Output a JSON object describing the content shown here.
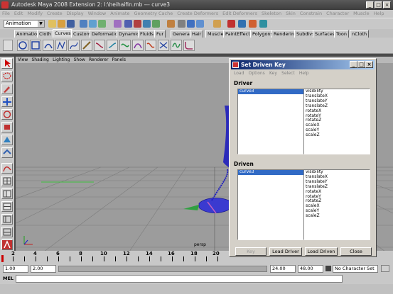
{
  "window": {
    "title": "Autodesk Maya 2008 Extension 2: I:\\heihaifin.mb  ---  curve3",
    "min": "_",
    "max": "□",
    "close": "×"
  },
  "menubar": [
    "File",
    "Edit",
    "Modify",
    "Create",
    "Display",
    "Window",
    "Animate",
    "Geometry Cache",
    "Create Deformers",
    "Edit Deformers",
    "Skeleton",
    "Skin",
    "Constrain",
    "Character",
    "Muscle",
    "Help"
  ],
  "statusline": {
    "mode": "Animation"
  },
  "shelf_tabs": [
    "Animation",
    "Cloth",
    "Curves",
    "Custom",
    "Deformation",
    "Dynamics",
    "Fluids",
    "Fur",
    "General",
    "Hair",
    "Muscle",
    "PaintEffects",
    "Polygons",
    "Rendering",
    "Subdivs",
    "Surfaces",
    "Toon",
    "nCloth"
  ],
  "active_shelf": "Curves",
  "viewport": {
    "menu": [
      "View",
      "Shading",
      "Lighting",
      "Show",
      "Renderer",
      "Panels"
    ],
    "camera_label": "persp"
  },
  "timeline": {
    "labels": [
      "2",
      "4",
      "6",
      "8",
      "10",
      "12",
      "14",
      "16",
      "18",
      "20"
    ]
  },
  "range": {
    "start": "1.00",
    "inner_start": "2.00",
    "end": "24.00",
    "inner_end": "48.00",
    "character_set": "No Character Set"
  },
  "cmdline": {
    "label": "MEL"
  },
  "dialog": {
    "title": "Set Driven Key",
    "menu": [
      "Load",
      "Options",
      "Key",
      "Select",
      "Help"
    ],
    "driver_label": "Driver",
    "driven_label": "Driven",
    "driver_objects": [
      "curve3"
    ],
    "driven_objects": [
      "curve3"
    ],
    "attributes": [
      "visibility",
      "translateX",
      "translateY",
      "translateZ",
      "rotateX",
      "rotateY",
      "rotateZ",
      "scaleX",
      "scaleY",
      "scaleZ"
    ],
    "buttons": {
      "key": "Key",
      "load_driver": "Load Driver",
      "load_driven": "Load Driven",
      "close": "Close"
    }
  }
}
